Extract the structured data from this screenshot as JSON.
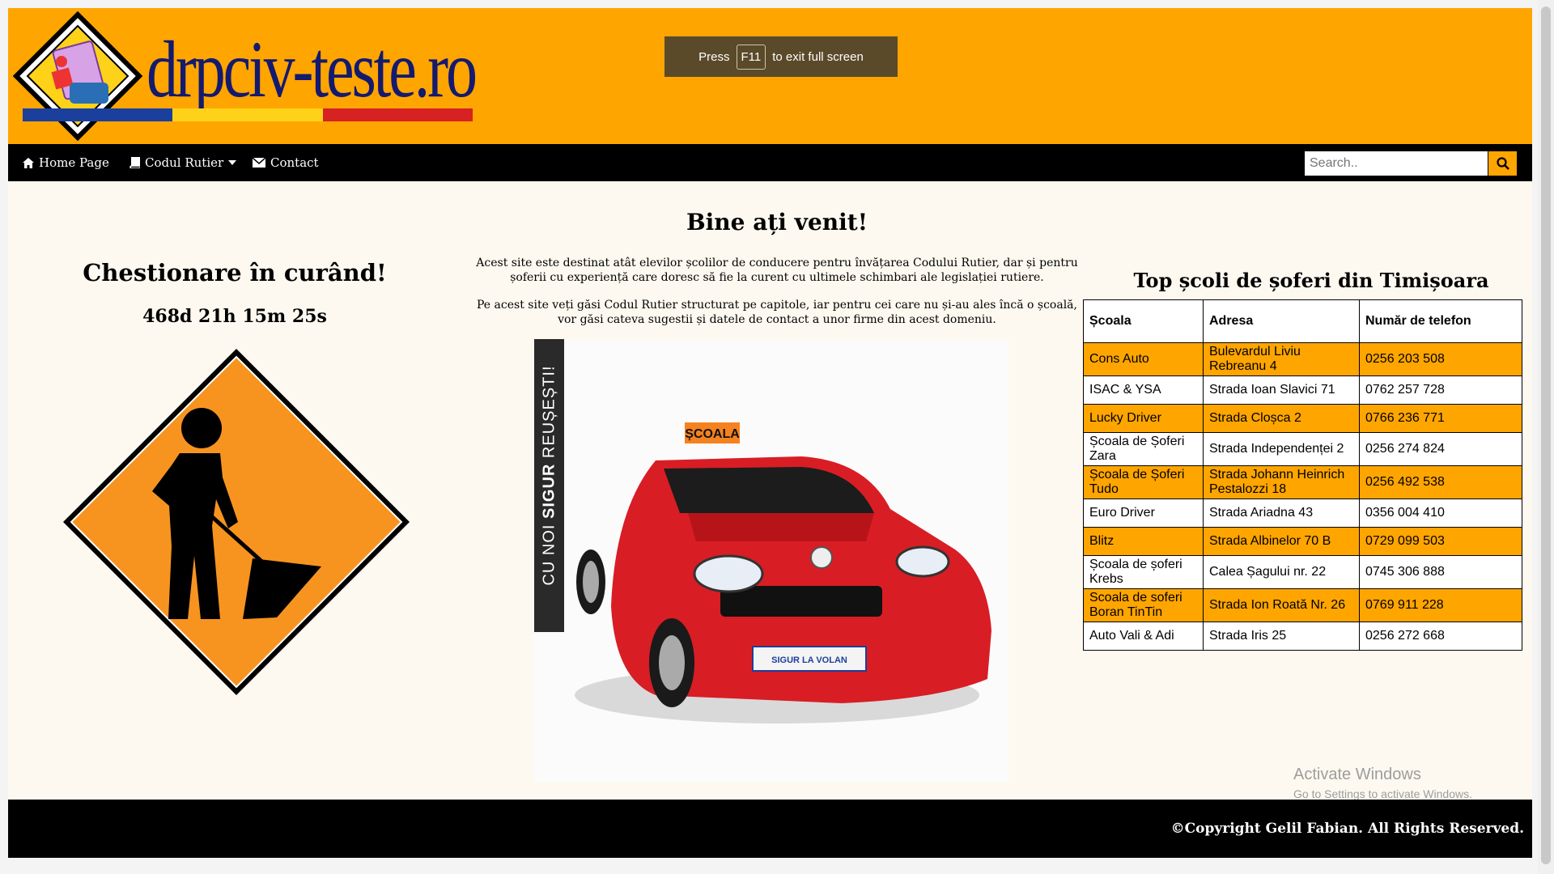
{
  "header": {
    "logo_text": "drpciv-teste.ro",
    "fullscreen_toast": {
      "before": "Press",
      "key": "F11",
      "after": "to exit full screen"
    }
  },
  "nav": {
    "items": [
      {
        "label": "Home Page",
        "icon": "home-icon"
      },
      {
        "label": "Codul Rutier",
        "icon": "book-icon",
        "dropdown": true
      },
      {
        "label": "Contact",
        "icon": "envelope-icon"
      }
    ],
    "search": {
      "placeholder": "Search.."
    }
  },
  "left": {
    "title": "Chestionare în curând!",
    "countdown": "468d 21h 15m 25s"
  },
  "center": {
    "title": "Bine ați venit!",
    "paragraph1": "Acest site este destinat atât elevilor școlilor de conducere pentru învățarea Codului Rutier, dar și pentru șoferii cu experiență care doresc să fie la curent cu ultimele schimbari ale legislației rutiere.",
    "paragraph2": "Pe acest site veți găsi Codul Rutier structurat pe capitole, iar pentru cei care nu și-au ales încă o școală, vor găsi cateva sugestii și datele de contact a unor firme din acest domeniu.",
    "banner": {
      "prefix": "CU NOI ",
      "bold": "SIGUR",
      "suffix": " REUȘEȘTI!"
    },
    "car_roof_sign": "ȘCOALA",
    "plate_text": "SIGUR LA VOLAN"
  },
  "right": {
    "title": "Top școli de șoferi din Timișoara",
    "headers": [
      "Școala",
      "Adresa",
      "Număr de telefon"
    ],
    "rows": [
      [
        "Cons Auto",
        "Bulevardul Liviu Rebreanu 4",
        "0256 203 508"
      ],
      [
        "ISAC & YSA",
        "Strada Ioan Slavici 71",
        "0762 257 728"
      ],
      [
        "Lucky Driver",
        "Strada Cloșca 2",
        "0766 236 771"
      ],
      [
        "Școala de Șoferi Zara",
        "Strada Independenței 2",
        "0256 274 824"
      ],
      [
        "Școala de Șoferi Tudo",
        "Strada Johann Heinrich Pestalozzi 18",
        "0256 492 538"
      ],
      [
        "Euro Driver",
        "Strada Ariadna 43",
        "0356 004 410"
      ],
      [
        "Blitz",
        "Strada Albinelor 70 B",
        "0729 099 503"
      ],
      [
        "Școala de șoferi Krebs",
        "Calea Șagului nr. 22",
        "0745 306 888"
      ],
      [
        "Scoala de soferi Boran TinTin",
        "Strada Ion Roată Nr. 26",
        "0769 911 228"
      ],
      [
        "Auto Vali & Adi",
        "Strada Iris 25",
        "0256 272 668"
      ]
    ]
  },
  "watermark": {
    "line1": "Activate Windows",
    "line2": "Go to Settings to activate Windows."
  },
  "footer": {
    "copyright": "©Copyright Gelil Fabian. All Rights Reserved."
  },
  "colors": {
    "accent": "#ffa500",
    "nav_bg": "#000000",
    "page_bg": "#fdf9f0",
    "logo_text": "#141a6e"
  }
}
